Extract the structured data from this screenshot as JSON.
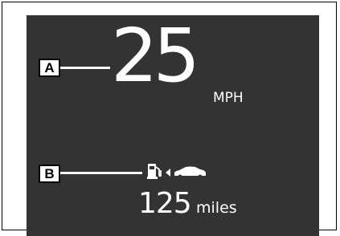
{
  "display": {
    "speed_value": "25",
    "speed_unit": "MPH",
    "range_value": "125",
    "range_unit": "miles"
  },
  "callouts": {
    "a": "A",
    "b": "B"
  },
  "icons": {
    "fuel": "fuel-pump-icon",
    "arrow": "triangle-left-icon",
    "car": "car-icon"
  },
  "colors": {
    "screen_bg": "#333333",
    "text": "#ffffff"
  }
}
